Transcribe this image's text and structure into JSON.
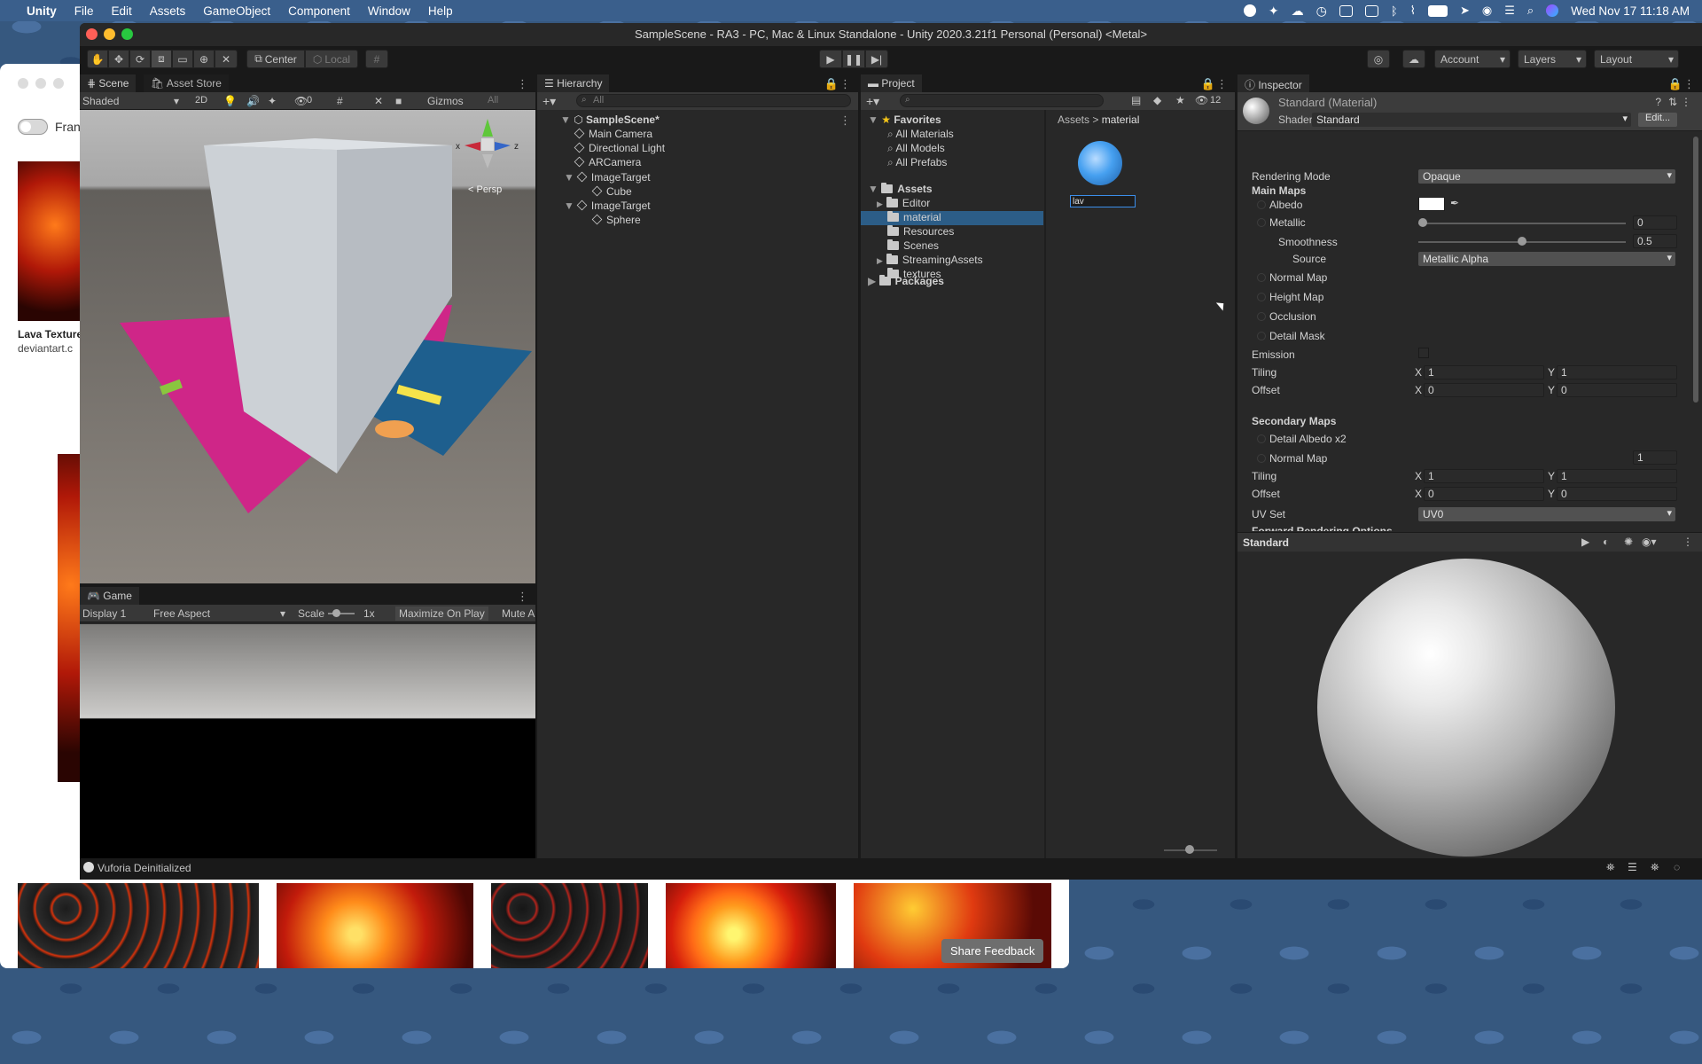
{
  "menubar": {
    "apple": "",
    "app_name": "Unity",
    "menus": [
      "File",
      "Edit",
      "Assets",
      "GameObject",
      "Component",
      "Window",
      "Help"
    ],
    "clock": "Wed Nov 17  11:18 AM"
  },
  "browser": {
    "toggle_label": "Fran",
    "card_title": "Lava Texture",
    "card_source": "deviantart.c",
    "share_feedback": "Share Feedback"
  },
  "window": {
    "title": "SampleScene - RA3 - PC, Mac & Linux Standalone - Unity 2020.3.21f1 Personal (Personal) <Metal>"
  },
  "toolbar": {
    "center": "Center",
    "local": "Local",
    "account": "Account",
    "layers": "Layers",
    "layout": "Layout"
  },
  "scene": {
    "tab_scene": "Scene",
    "tab_asset_store": "Asset Store",
    "shading": "Shaded",
    "mode_2d": "2D",
    "hidden_count": "0",
    "gizmos": "Gizmos",
    "search": "All",
    "persp": "< Persp",
    "axes": [
      "x",
      "z"
    ]
  },
  "game": {
    "tab": "Game",
    "display": "Display 1",
    "aspect": "Free Aspect",
    "scale_label": "Scale",
    "scale_value": "1x",
    "maximize": "Maximize On Play",
    "mute": "Mute A"
  },
  "hierarchy": {
    "tab": "Hierarchy",
    "search": "All",
    "scene": "SampleScene*",
    "items": [
      {
        "label": "Main Camera",
        "depth": 1,
        "arrow": ""
      },
      {
        "label": "Directional Light",
        "depth": 1,
        "arrow": ""
      },
      {
        "label": "ARCamera",
        "depth": 1,
        "arrow": ""
      },
      {
        "label": "ImageTarget",
        "depth": 1,
        "arrow": "▼"
      },
      {
        "label": "Cube",
        "depth": 2,
        "arrow": ""
      },
      {
        "label": "ImageTarget",
        "depth": 1,
        "arrow": "▼"
      },
      {
        "label": "Sphere",
        "depth": 2,
        "arrow": ""
      }
    ]
  },
  "project": {
    "tab": "Project",
    "hidden_count": "12",
    "favorites": "Favorites",
    "favorite_items": [
      "All Materials",
      "All Models",
      "All Prefabs"
    ],
    "assets": "Assets",
    "asset_folders": [
      {
        "label": "Editor",
        "arrow": "▶",
        "selected": false
      },
      {
        "label": "material",
        "arrow": "",
        "selected": true
      },
      {
        "label": "Resources",
        "arrow": "",
        "selected": false
      },
      {
        "label": "Scenes",
        "arrow": "",
        "selected": false
      },
      {
        "label": "StreamingAssets",
        "arrow": "▶",
        "selected": false
      },
      {
        "label": "textures",
        "arrow": "",
        "selected": false
      }
    ],
    "packages": "Packages",
    "breadcrumb": [
      "Assets",
      "material"
    ],
    "new_asset_name": "lav"
  },
  "inspector": {
    "tab": "Inspector",
    "material_name": "Standard (Material)",
    "shader_label": "Shader",
    "shader_value": "Standard",
    "edit": "Edit...",
    "rendering_mode_label": "Rendering Mode",
    "rendering_mode": "Opaque",
    "main_maps": "Main Maps",
    "albedo": "Albedo",
    "albedo_color": "#ffffff",
    "metallic": "Metallic",
    "metallic_value": "0",
    "smoothness": "Smoothness",
    "smoothness_value": "0.5",
    "source_label": "Source",
    "source_value": "Metallic Alpha",
    "normal_map": "Normal Map",
    "height_map": "Height Map",
    "occlusion": "Occlusion",
    "detail_mask": "Detail Mask",
    "emission": "Emission",
    "tiling": "Tiling",
    "offset": "Offset",
    "x": "X",
    "y": "Y",
    "tiling_x": "1",
    "tiling_y": "1",
    "offset_x": "0",
    "offset_y": "0",
    "secondary_maps": "Secondary Maps",
    "detail_albedo": "Detail Albedo x2",
    "normal_map2": "Normal Map",
    "normal_map2_value": "1",
    "tiling2_x": "1",
    "tiling2_y": "1",
    "offset2_x": "0",
    "offset2_y": "0",
    "uv_set_label": "UV Set",
    "uv_set": "UV0",
    "forward": "Forward Rendering Options",
    "preview_label": "Standard"
  },
  "status": {
    "message": "Vuforia Deinitialized"
  },
  "colors": {
    "accent_blue": "#2c5d87",
    "panel": "#282828",
    "magenta_plane": "#d0218a"
  }
}
